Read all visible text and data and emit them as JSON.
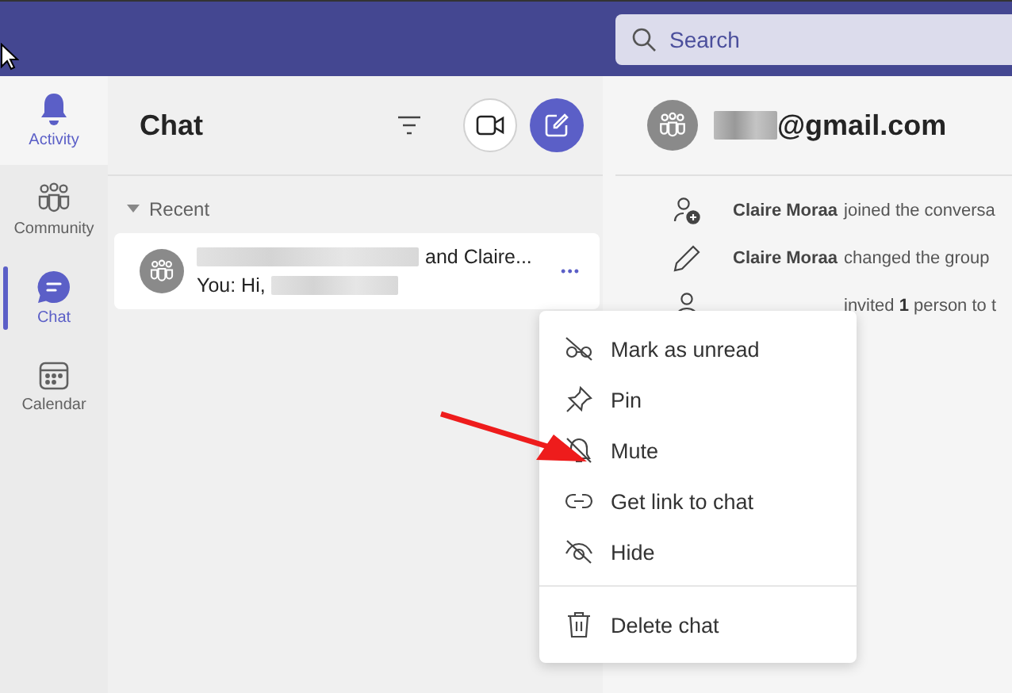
{
  "top_bar": {
    "search": {
      "placeholder": "Search"
    }
  },
  "rail": [
    {
      "label": "Activity",
      "selected": false,
      "hovered": true
    },
    {
      "label": "Community",
      "selected": false,
      "hovered": false
    },
    {
      "label": "Chat",
      "selected": true,
      "hovered": false
    },
    {
      "label": "Calendar",
      "selected": false,
      "hovered": false
    }
  ],
  "chat_list": {
    "title": "Chat",
    "section": "Recent",
    "expanded": true,
    "items": [
      {
        "title": "and Claire...",
        "preview": "You: Hi,",
        "more": "•••"
      }
    ]
  },
  "conversation": {
    "title": "@gmail.com",
    "events": [
      {
        "name": "Claire Moraa",
        "text": "joined the conversa"
      },
      {
        "name": "Claire Moraa",
        "text": "changed the group"
      },
      {
        "text": "invited **1** person to t"
      }
    ]
  },
  "context_menu": [
    {
      "kind": "item",
      "label": "Mark as unread"
    },
    {
      "kind": "item",
      "label": "Pin"
    },
    {
      "kind": "item",
      "label": "Mute"
    },
    {
      "kind": "item",
      "label": "Get link to chat"
    },
    {
      "kind": "item",
      "label": "Hide"
    },
    {
      "kind": "divider"
    },
    {
      "kind": "item",
      "label": "Delete chat"
    }
  ]
}
